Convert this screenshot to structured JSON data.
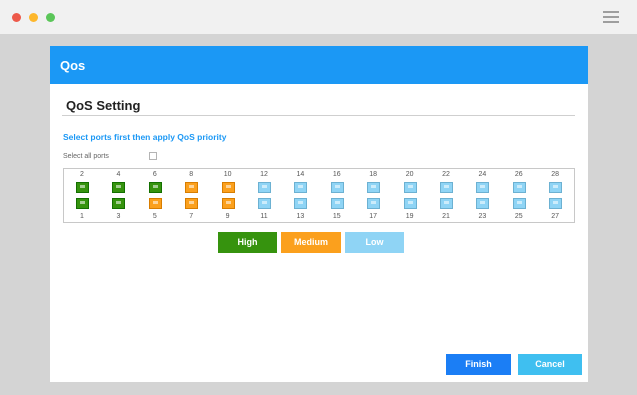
{
  "window": {
    "title": "Qos"
  },
  "section": {
    "title": "QoS Setting"
  },
  "instruction": "Select ports first then apply QoS priority",
  "select_all": {
    "label": "Select all ports",
    "checked": false
  },
  "colors": {
    "accent": "#1b98f5",
    "high": "#36930e",
    "medium": "#fba01d",
    "low": "#8fd4f5",
    "finish": "#1b7ef5",
    "cancel": "#3fbff0"
  },
  "ports": {
    "even": [
      {
        "number": "2",
        "priority": "high"
      },
      {
        "number": "4",
        "priority": "high"
      },
      {
        "number": "6",
        "priority": "high"
      },
      {
        "number": "8",
        "priority": "medium"
      },
      {
        "number": "10",
        "priority": "medium"
      },
      {
        "number": "12",
        "priority": "low"
      },
      {
        "number": "14",
        "priority": "low"
      },
      {
        "number": "16",
        "priority": "low"
      },
      {
        "number": "18",
        "priority": "low"
      },
      {
        "number": "20",
        "priority": "low"
      },
      {
        "number": "22",
        "priority": "low"
      },
      {
        "number": "24",
        "priority": "low"
      },
      {
        "number": "26",
        "priority": "low"
      },
      {
        "number": "28",
        "priority": "low"
      }
    ],
    "odd": [
      {
        "number": "1",
        "priority": "high"
      },
      {
        "number": "3",
        "priority": "high"
      },
      {
        "number": "5",
        "priority": "medium"
      },
      {
        "number": "7",
        "priority": "medium"
      },
      {
        "number": "9",
        "priority": "medium"
      },
      {
        "number": "11",
        "priority": "low"
      },
      {
        "number": "13",
        "priority": "low"
      },
      {
        "number": "15",
        "priority": "low"
      },
      {
        "number": "17",
        "priority": "low"
      },
      {
        "number": "19",
        "priority": "low"
      },
      {
        "number": "21",
        "priority": "low"
      },
      {
        "number": "23",
        "priority": "low"
      },
      {
        "number": "25",
        "priority": "low"
      },
      {
        "number": "27",
        "priority": "low"
      }
    ]
  },
  "priority_buttons": {
    "high": "High",
    "medium": "Medium",
    "low": "Low"
  },
  "actions": {
    "finish": "Finish",
    "cancel": "Cancel"
  }
}
